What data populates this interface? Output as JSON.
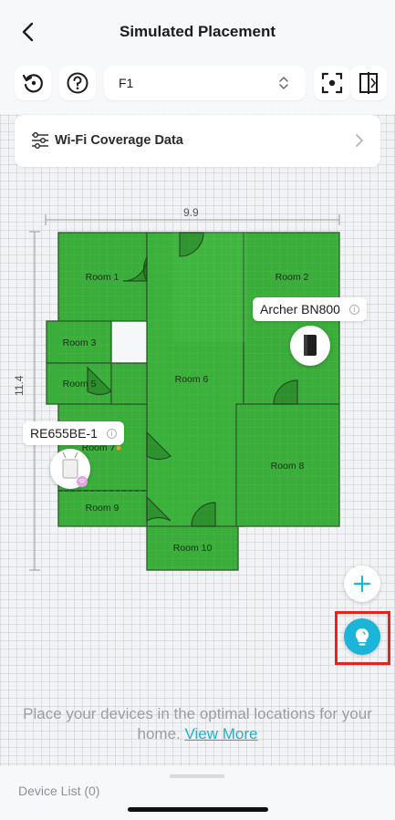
{
  "header": {
    "title": "Simulated Placement"
  },
  "toolbar": {
    "floor_value": "F1",
    "icons": [
      "history-icon",
      "help-icon",
      "up-down-chevron-icon",
      "focus-icon",
      "split-view-icon"
    ]
  },
  "coverage": {
    "label": "Wi-Fi Coverage Data"
  },
  "plan": {
    "width_label": "9.9",
    "height_label": "11.4",
    "rooms": [
      "Room 1",
      "Room 2",
      "Room 3",
      "Room 5",
      "Room 6",
      "Room 7",
      "Room 8",
      "Room 9",
      "Room 10"
    ]
  },
  "devices": {
    "router": {
      "name": "Archer BN800"
    },
    "extender": {
      "name": "RE655BE-1"
    }
  },
  "hint": {
    "text": "Place your devices in the optimal locations for your home.",
    "link": "View More"
  },
  "bottom": {
    "device_list": "Device List (0)"
  },
  "colors": {
    "accent": "#1cb5d8",
    "coverage_green": "#3aad3a",
    "highlight": "#e8231f"
  }
}
